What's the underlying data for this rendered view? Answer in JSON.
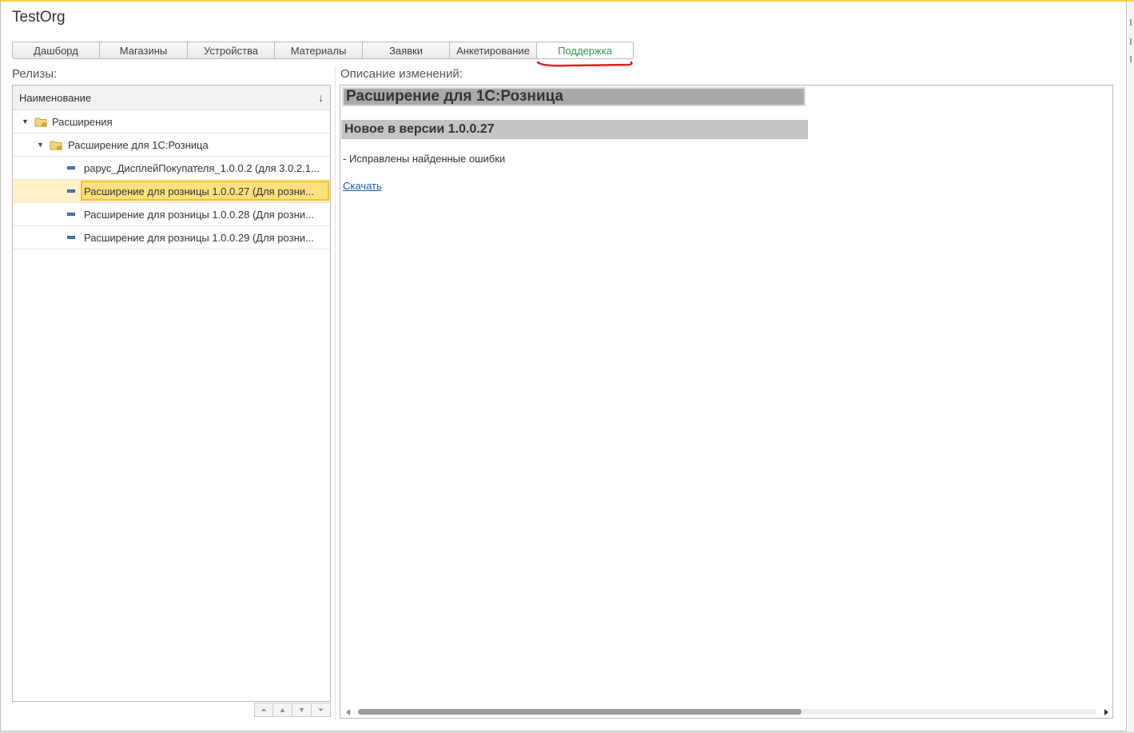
{
  "window": {
    "title": "TestOrg"
  },
  "tabs": [
    {
      "label": "Дашборд",
      "active": false
    },
    {
      "label": "Магазины",
      "active": false
    },
    {
      "label": "Устройства",
      "active": false
    },
    {
      "label": "Материалы",
      "active": false
    },
    {
      "label": "Заявки",
      "active": false
    },
    {
      "label": "Анкетирование",
      "active": false
    },
    {
      "label": "Поддержка",
      "active": true
    }
  ],
  "releases": {
    "label": "Релизы:",
    "column_header": "Наименование",
    "sort_icon": "sort-down-icon",
    "tree": [
      {
        "label": "Расширения",
        "icon": "folder-icon",
        "level": 0,
        "expanded": true
      },
      {
        "label": "Расширение для 1С:Розница",
        "icon": "folder-icon",
        "level": 1,
        "expanded": true
      },
      {
        "label": "рарус_ДисплейПокупателя_1.0.0.2 (для 3.0.2.1...",
        "icon": "item-icon",
        "level": 2
      },
      {
        "label": "Расширение для розницы 1.0.0.27 (Для розни...",
        "icon": "item-icon",
        "level": 2,
        "selected": true
      },
      {
        "label": "Расширение для розницы 1.0.0.28 (Для розни...",
        "icon": "item-icon",
        "level": 2
      },
      {
        "label": "Расширение для розницы 1.0.0.29 (Для розни...",
        "icon": "item-icon",
        "level": 2
      }
    ]
  },
  "description": {
    "label": "Описание изменений:",
    "heading": "Расширение для 1С:Розница",
    "subheading": "Новое в версии 1.0.0.27",
    "text": "- Исправлены найденные ошибки",
    "link": "Скачать"
  },
  "colors": {
    "active_tab": "#2f9a4b",
    "selection": "#fde07f",
    "annotation": "#e02020"
  }
}
